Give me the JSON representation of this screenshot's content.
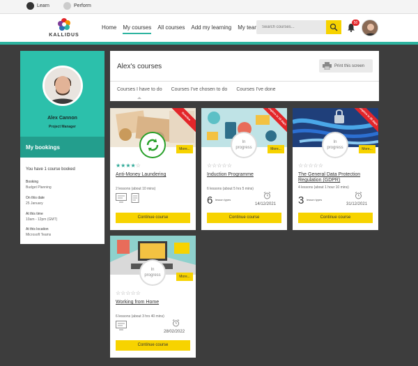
{
  "topbar": {
    "learn_label": "Learn",
    "perform_label": "Perform"
  },
  "logo": {
    "text": "KALLIDUS"
  },
  "nav": {
    "items": [
      "Home",
      "My courses",
      "All courses",
      "Add my learning",
      "My team"
    ],
    "active_index": 1
  },
  "search": {
    "placeholder": "Search courses..."
  },
  "notifications": {
    "count": "50"
  },
  "profile": {
    "name": "Alex Cannon",
    "role": "Project Manager"
  },
  "bookings": {
    "heading": "My bookings",
    "intro": "You have 1 course booked",
    "booking_label": "Booking",
    "booking_value": "Budget Planning",
    "date_label": "On this date",
    "date_value": "25 January",
    "time_label": "At this time",
    "time_value": "10am - 12pm (GMT)",
    "location_label": "At this location",
    "location_value": "Microsoft Teams"
  },
  "main": {
    "title": "Alex's courses",
    "print_label": "Print this screen",
    "tabs": [
      "Courses I have to do",
      "Courses I've chosen to do",
      "Courses I've done"
    ]
  },
  "cards": [
    {
      "title": "Anti-Money Laundering",
      "ribbon": "Overdue",
      "status": "",
      "rating": 4,
      "lessons": "2 lessons (about 10 mins)",
      "lesson_types": "",
      "lesson_types_label": "",
      "due": "",
      "more": "More...",
      "continue": "Continue course"
    },
    {
      "title": "Induction Programme",
      "ribbon": "Expires in 18 days",
      "status": "In progress",
      "rating": 0,
      "lessons": "6 lessons (about 5 hrs 5 mins)",
      "lesson_types": "6",
      "lesson_types_label": "lesson types",
      "due": "14/12/2021",
      "more": "More...",
      "continue": "Continue course"
    },
    {
      "title": "The General Data Protection Regulation (GDPR)",
      "ribbon": "Expires in 35 days",
      "status": "In progress",
      "rating": 0,
      "lessons": "4 lessons (about 1 hour 10 mins)",
      "lesson_types": "3",
      "lesson_types_label": "lesson types",
      "due": "31/12/2021",
      "more": "More...",
      "continue": "Continue course"
    },
    {
      "title": "Working from Home",
      "ribbon": "",
      "status": "In progress",
      "rating": 0,
      "lessons": "6 lessons (about 3 hrs 40 mins)",
      "lesson_types": "",
      "lesson_types_label": "",
      "due": "28/02/2022",
      "more": "More...",
      "continue": "Continue course"
    }
  ],
  "colors": {
    "teal": "#2cc0ab",
    "teal_dark": "#239e8d",
    "yellow": "#f7d300",
    "red": "#e3262a",
    "background": "#3d3d3d"
  }
}
